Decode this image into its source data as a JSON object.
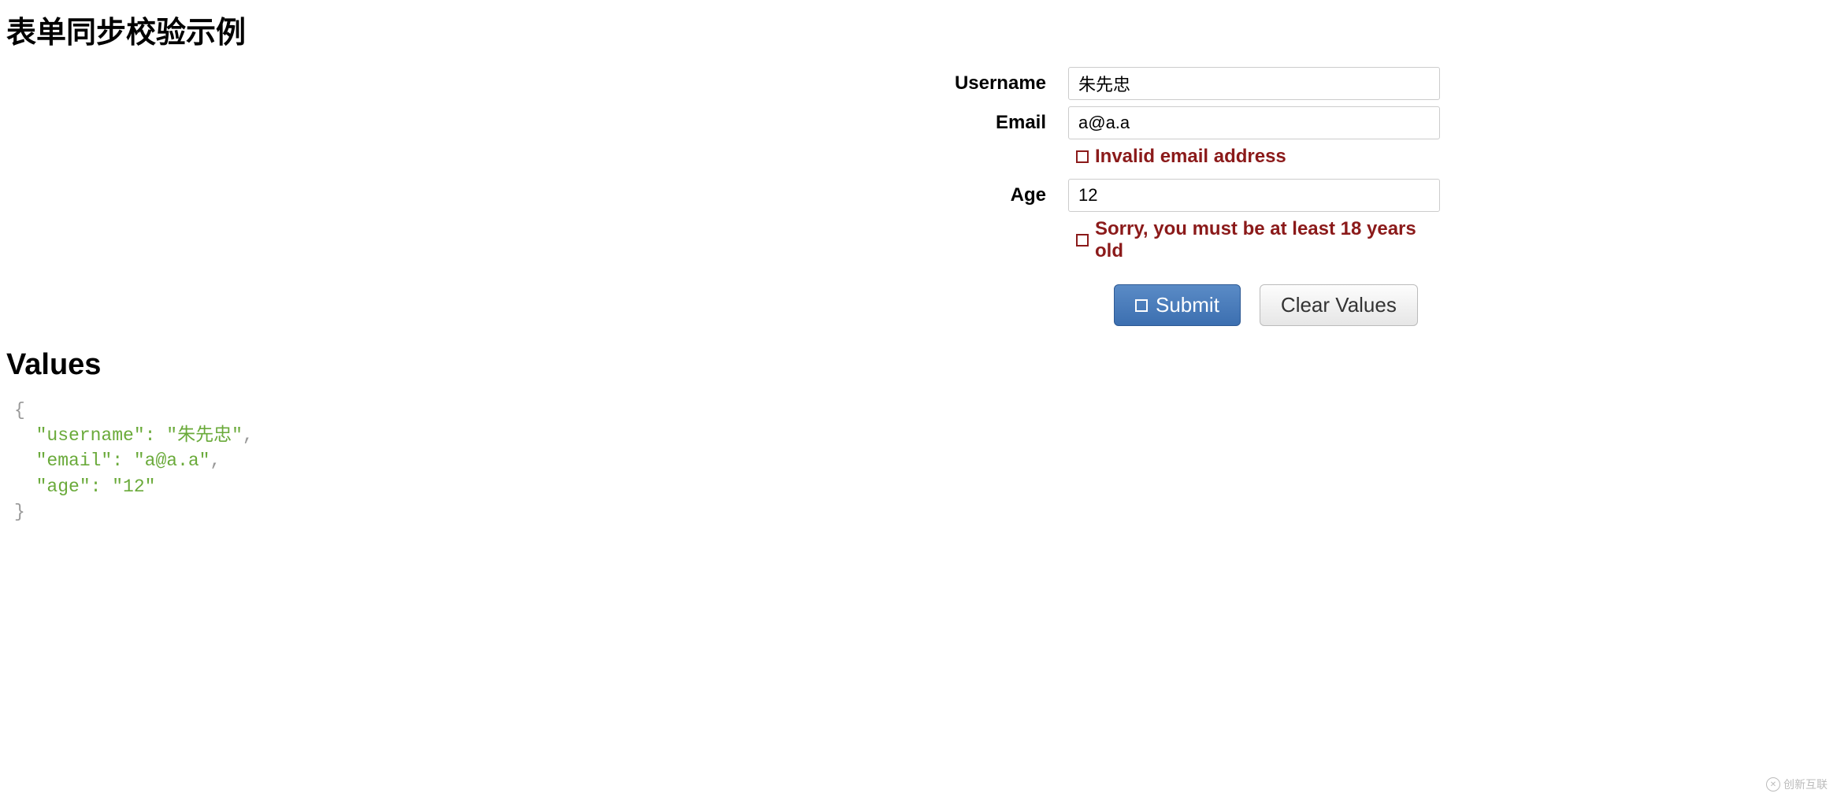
{
  "page": {
    "title": "表单同步校验示例",
    "values_heading": "Values"
  },
  "form": {
    "username": {
      "label": "Username",
      "value": "朱先忠"
    },
    "email": {
      "label": "Email",
      "value": "a@a.a",
      "error": "Invalid email address"
    },
    "age": {
      "label": "Age",
      "value": "12",
      "error": "Sorry, you must be at least 18 years old"
    },
    "submit_label": "Submit",
    "clear_label": "Clear Values"
  },
  "values_json": {
    "username": "朱先忠",
    "email": "a@a.a",
    "age": "12"
  },
  "watermark": {
    "text": "创新互联"
  }
}
